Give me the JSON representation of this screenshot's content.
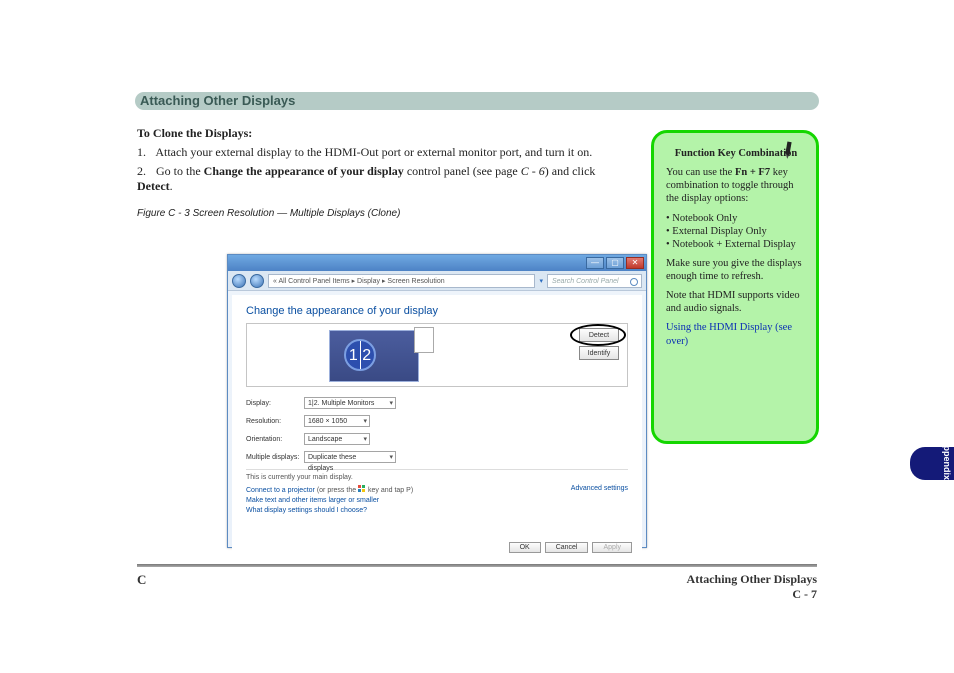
{
  "header": {
    "title": "Attaching Other Displays"
  },
  "instr": {
    "heading_bold": "To Clone the Displays:",
    "step1_num": "1.",
    "step1_a": "Attach your external display to the HDMI-Out port or external monitor port, and turn it on.",
    "step2_num": "2.",
    "step2_a": "Go to the ",
    "step2_b": "Change the appearance of your display",
    "step2_c": " control panel (see page ",
    "step2_d": "C - 6",
    "step2_e": ") and click ",
    "step2_f": "Detect",
    "step2_g": "."
  },
  "win": {
    "crumb": "«  All Control Panel Items  ▸  Display  ▸  Screen Resolution",
    "search_ph": "Search Control Panel",
    "head": "Change the appearance of your display",
    "btn_detect": "Detect",
    "btn_identify": "Identify",
    "mon_label": "1 2",
    "lbl_display": "Display:",
    "val_display": "1|2. Multiple Monitors",
    "lbl_res": "Resolution:",
    "val_res": "1680 × 1050",
    "lbl_ori": "Orientation:",
    "val_ori": "Landscape",
    "lbl_mult": "Multiple displays:",
    "val_mult": "Duplicate these displays",
    "note_main": "This is currently your main display.",
    "adv": "Advanced settings",
    "link_proj_a": "Connect to a projector",
    "link_proj_b": " (or press the ",
    "link_proj_c": " key and tap P)",
    "link_text": "Make text and other items larger or smaller",
    "link_which": "What display settings should I choose?",
    "btn_ok": "OK",
    "btn_cancel": "Cancel",
    "btn_apply": "Apply",
    "dropdown_arrow": "▾"
  },
  "note": {
    "title": "Function Key Combination",
    "p1a": "You can use the ",
    "p1b": "Fn + F7",
    "p1c": " key combination to toggle through the display options:",
    "b1": "• Notebook Only",
    "b2": "• External Display Only",
    "b3": "• Notebook + External Display",
    "p2a": "Make sure you give the displays enough time to refresh.",
    "p3a": "Note that HDMI supports video and audio signals.",
    "hotlink_label": "Using the HDMI Display (see over)"
  },
  "sidetab": {
    "text": "Appendix"
  },
  "footer": {
    "left": "C",
    "right_top": "Attaching Other Displays",
    "right_bot": "C - 7"
  },
  "fig_label": "Figure C - 3  Screen Resolution — Multiple Displays (Clone)"
}
